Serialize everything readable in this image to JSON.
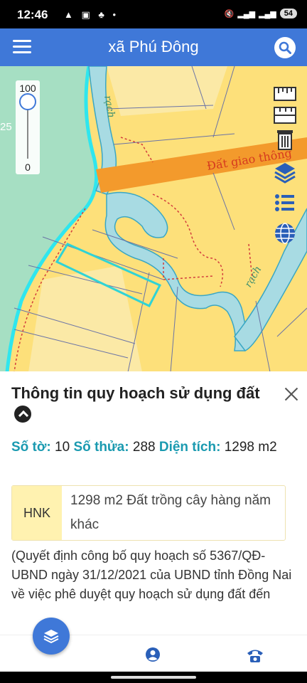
{
  "status_bar": {
    "time": "12:46",
    "battery": "54"
  },
  "app_bar": {
    "title": "xã Phú Đông"
  },
  "map": {
    "zoom_max": "100",
    "zoom_min": "0",
    "road_label": "Đất giao thông",
    "river_label_top": "rạch",
    "river_label_right": "rạch",
    "edge_number": "25",
    "colors": {
      "residential": "#fde07a",
      "road": "#f39a2c",
      "river": "#a8dbe3",
      "water": "#a6dfc3",
      "highlight": "#2fd3d6"
    }
  },
  "panel": {
    "title": "Thông tin quy hoạch sử dụng đất",
    "sheet_label": "Số tờ:",
    "sheet_value": "10",
    "parcel_label": "Số thửa:",
    "parcel_value": "288",
    "area_label": "Diện tích:",
    "area_value": "1298 m2",
    "landuse_code": "HNK",
    "landuse_desc": "1298 m2 Đất trồng cây hàng năm khác",
    "decision_text": "(Quyết định công bố quy hoạch số 5367/QĐ-UBND ngày 31/12/2021 của UBND tỉnh Đồng Nai về việc phê duyệt quy hoạch sử dụng đất đến"
  },
  "icons": [
    "menu-icon",
    "search-icon",
    "ruler-icon",
    "trash-icon",
    "layers-icon",
    "legend-icon",
    "globe-icon",
    "close-icon",
    "user-icon",
    "phone-icon"
  ]
}
